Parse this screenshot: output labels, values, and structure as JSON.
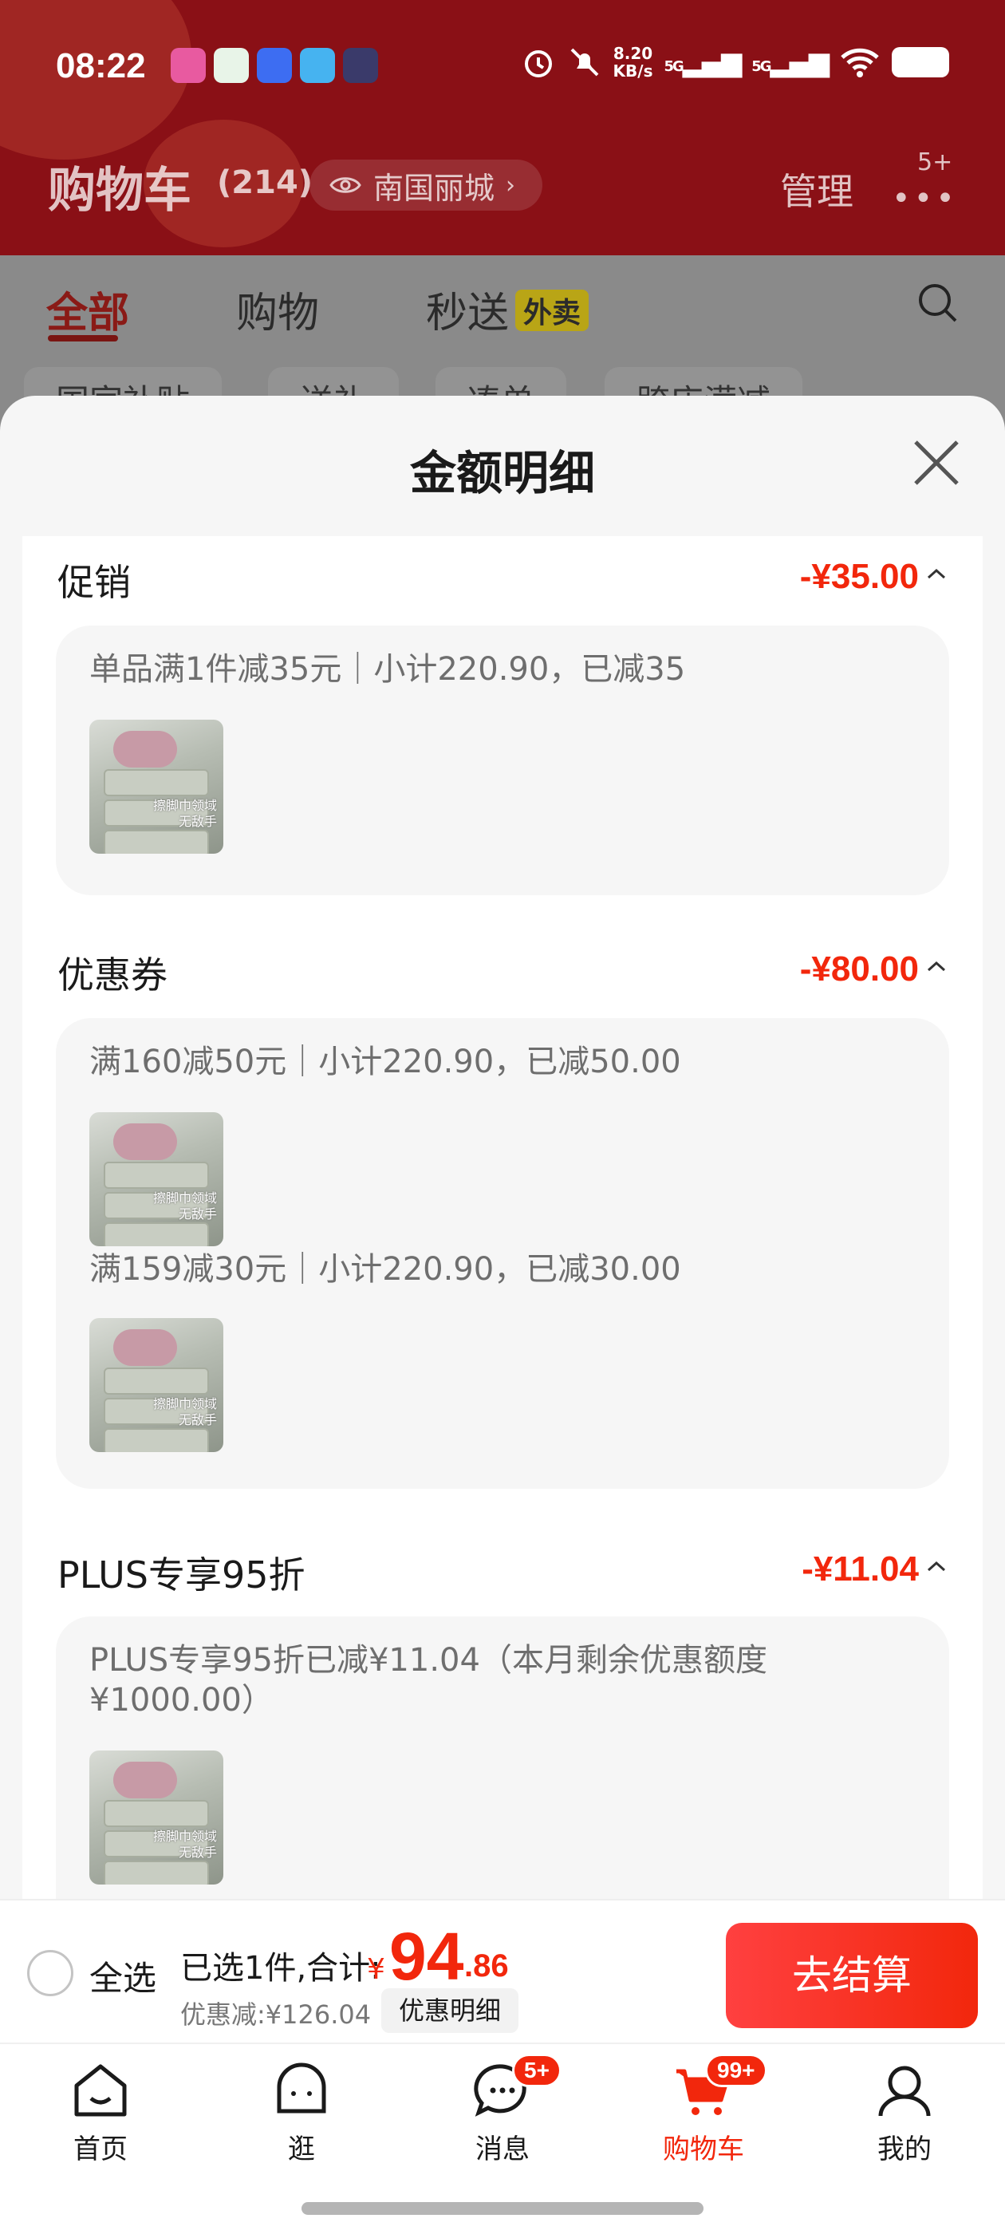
{
  "status_bar": {
    "time": "08:22",
    "net_rate": "8.20",
    "net_unit": "KB/s",
    "sig1": "5G",
    "sig2": "5G"
  },
  "header": {
    "title": "购物车",
    "count": "(214)",
    "location": "南国丽城",
    "manage": "管理",
    "more_badge": "5+"
  },
  "tabs": [
    {
      "label": "全部"
    },
    {
      "label": "购物"
    },
    {
      "label": "秒送"
    }
  ],
  "waimai_tag": "外卖",
  "filter_chips": [
    "国家补贴",
    "送礼",
    "凑单",
    "跨店满减"
  ],
  "modal": {
    "title": "金额明细",
    "sections": [
      {
        "name": "促销",
        "amount": "-¥35.00",
        "lines": [
          "单品满1件减35元｜小计220.90，已减35"
        ]
      },
      {
        "name": "优惠券",
        "amount": "-¥80.00",
        "lines": [
          "满160减50元｜小计220.90，已减50.00",
          "满159减30元｜小计220.90，已减30.00"
        ]
      },
      {
        "name": "PLUS专享95折",
        "amount": "-¥11.04",
        "lines": [
          "PLUS专享95折已减¥11.04（本月剩余优惠额度",
          "¥1000.00）"
        ]
      }
    ],
    "product_tag": [
      "擦脚巾领域",
      "无敌手"
    ]
  },
  "checkout": {
    "select_all": "全选",
    "summary": "已选1件,合计:",
    "currency": "¥",
    "price_int": "94",
    "price_dec": ".86",
    "discount": "优惠减:¥126.04",
    "detail": "优惠明细",
    "button": "去结算"
  },
  "nav": [
    {
      "label": "首页",
      "icon": "home-icon"
    },
    {
      "label": "逛",
      "icon": "browse-icon"
    },
    {
      "label": "消息",
      "icon": "message-icon",
      "badge": "5+"
    },
    {
      "label": "购物车",
      "icon": "cart-icon",
      "badge": "99+",
      "active": true
    },
    {
      "label": "我的",
      "icon": "profile-icon"
    }
  ],
  "colors": {
    "accent": "#f2270c",
    "header_bg": "#8a1016",
    "overlay_bg": "#8a8a8a"
  }
}
